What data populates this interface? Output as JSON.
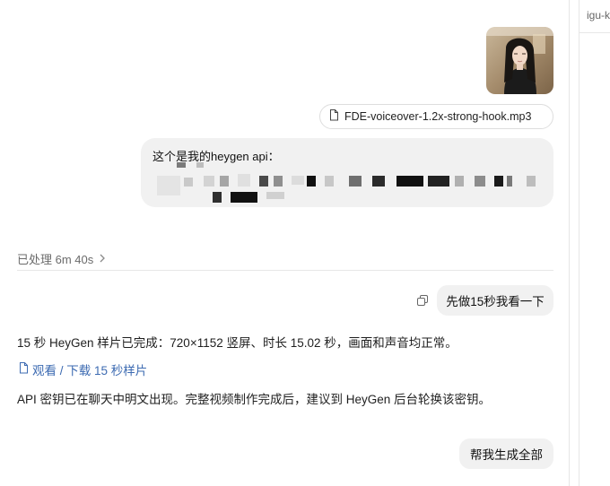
{
  "attachments": {
    "file_name": "FDE-voiceover-1.2x-strong-hook.mp3"
  },
  "messages": {
    "api_message_line1": "这个是我的heygen api：",
    "processed_label": "已处理 6m 40s",
    "user_msg_1": "先做15秒我看一下",
    "assistant_line_1": "15 秒 HeyGen 样片已完成：720×1152 竖屏、时长 15.02 秒，画面和声音均正常。",
    "assistant_link": "观看 / 下载 15 秒样片",
    "assistant_line_2": "API 密钥已在聊天中明文出现。完整视频制作完成后，建议到 HeyGen 后台轮换该密钥。",
    "user_msg_2": "帮我生成全部"
  },
  "right_panel": {
    "fragment": "igu-k"
  },
  "icons": {
    "file": "document-icon",
    "chevron": "chevron-right-icon",
    "copy": "copy-icon",
    "link": "document-link-icon"
  },
  "colors": {
    "bubble": "#f1f1f1",
    "link": "#3d6bb2",
    "muted": "#6b6b6b"
  }
}
